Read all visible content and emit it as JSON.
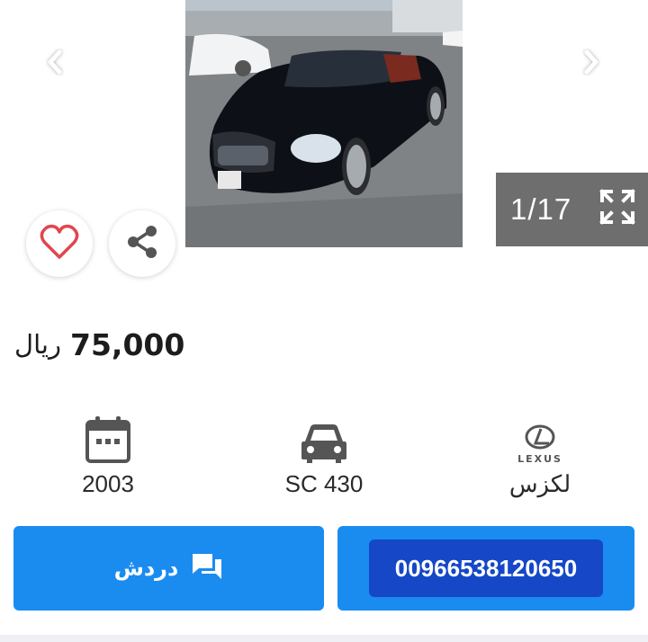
{
  "gallery": {
    "counter": "1/17",
    "photo_alt": "",
    "icons": {
      "prev": "chevron-left-icon",
      "next": "chevron-right-icon",
      "fullscreen": "fullscreen-icon",
      "favorite": "heart-icon",
      "share": "share-icon"
    }
  },
  "listing": {
    "price_amount": "75,000",
    "price_currency": "ريال"
  },
  "specs": {
    "year": "2003",
    "model": "SC 430",
    "make": "لكزس",
    "icons": {
      "year": "calendar-icon",
      "model": "car-icon",
      "make": "lexus-logo-icon"
    }
  },
  "actions": {
    "chat_label": "دردش",
    "phone_number": "00966538120650"
  },
  "colors": {
    "primary_button": "#1a8cf0",
    "phone_pill": "#1547c7",
    "counter_bg": "#6e6e6e",
    "heart": "#e0464e"
  }
}
